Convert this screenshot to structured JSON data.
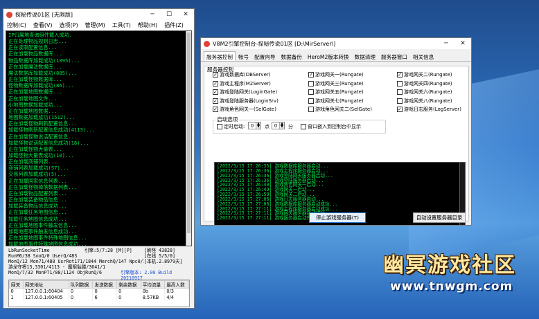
{
  "left_window": {
    "title": "探秘传说01区 [无限版]",
    "menu": [
      "控制(C)",
      "查看(V)",
      "选项(P)",
      "管理(M)",
      "工具(T)",
      "帮助(H)",
      "插件(Z)"
    ],
    "log_lines": [
      "IP归属地查询组件载入成功.",
      "正在处理物品规则日志...",
      "正在读取配置信息...",
      "正在加载物品数据库...",
      "物品数据库加载成功(1095)...",
      "正在加载魔法数据库...",
      "魔法数据库加载成功(885)...",
      "正在加载怪物数据库...",
      "怪物数据库加载成功(86)...",
      "正在加载地图数据库...",
      "正在加载地图文件...",
      "小地图数据加载成功...",
      "正在加载地图数据...",
      "地图数据加载成功(1512)...",
      "正在加载怪物刷新配置信息...",
      "加载怪物刷新配置信息成功(4113)...",
      "正在加载怪物说话配置信息...",
      "加载怪物说话配置信息成功(18)...",
      "正在加载怪物大量表...",
      "加载怪物大量表成功(10)...",
      "正在加载商铺列表...",
      "商铺列表加载成功(57)...",
      "交易列表加载成功(5)...",
      "正在加载国家信息列表...",
      "正在加载怪物掉落数据列表...",
      "正在加载物品配置列表...",
      "正在加载装备物品信息...",
      "加载装备物品信息成功...",
      "正在加载任务地图信息...",
      "加载任务地图信息成功...",
      "正在加载地图事件触发信息...",
      "加载地图事件触发信息成功...",
      "正在加载地图事件特殊地图信息...",
      "加载地图事件特殊地图信息成功...",
      "正在加载任务说明信息..."
    ],
    "stats": {
      "line1_left": "LbRunSocketTime",
      "line1_mid": "引擎:5/7:28 [M][P]",
      "line1_right": "[刷怪 43828]",
      "line2_left": "RunM6/38 SooQ/0 UserQ/483",
      "line2_right": "[在线 5/5/0]",
      "line3_left": "MonQ/12 Mon71/480 UsrRot171/1844 MerchQ/147 Npc0/135 (0)",
      "line3_right": "[本机.2.8979天]",
      "line4_left": "游龙守将13,3301/4113 - 魔眼骷髅/3641/1",
      "line5_left": "MonQ/7/32 MonP71/88/1124 ObjRunQ/6",
      "line5_right": "引擎版本: 2.00 Build 20210917"
    },
    "grid": {
      "headers": [
        "网关",
        "网关地址",
        "队列数据",
        "发送数据",
        "剩余数据",
        "平均流量",
        "最高人数"
      ],
      "rows": [
        [
          "0",
          "127.0.0.1:60404",
          "0",
          "0",
          "0",
          "0b",
          "0/3"
        ],
        [
          "1",
          "127.0.0.1:60405",
          "0",
          "6",
          "0",
          "8.57KB",
          "4/4"
        ]
      ]
    }
  },
  "right_window": {
    "title": "V8M2引擎控制台-探秘传说01区 [D:\\MirServer\\]",
    "tabs": [
      "服务器控制",
      "帐号",
      "配置向导",
      "数据备份",
      "HeroM2版本转换",
      "数据清理",
      "服务器窗口",
      "相关信息"
    ],
    "active_tab": 0,
    "section_server": "服务器控制",
    "checkboxes": [
      {
        "label": "游戏数据库(DBServer)",
        "checked": true
      },
      {
        "label": "游戏网关一(Rungate)",
        "checked": true
      },
      {
        "label": "游戏网关二(Rungate)",
        "checked": true
      },
      {
        "label": "游戏主程序(M2Server)",
        "checked": true
      },
      {
        "label": "游戏网关三(Rungate)",
        "checked": false
      },
      {
        "label": "游戏网关四(Rungate)",
        "checked": false
      },
      {
        "label": "游戏登陆网关(LoginGate)",
        "checked": true
      },
      {
        "label": "游戏网关五(Rungate)",
        "checked": false
      },
      {
        "label": "游戏网关六(Rungate)",
        "checked": false
      },
      {
        "label": "游戏登陆服务器(LoginSrv)",
        "checked": true
      },
      {
        "label": "游戏网关七(Rungate)",
        "checked": false
      },
      {
        "label": "游戏网关八(Rungate)",
        "checked": false
      },
      {
        "label": "游戏角色网关一(SelGate)",
        "checked": true
      },
      {
        "label": "游戏角色网关二(SelGate)",
        "checked": false
      },
      {
        "label": "游戏日志服务(LogServer)",
        "checked": true
      }
    ],
    "section_start": "启动选项",
    "timer_label": "定时启动:",
    "hour_value": "0",
    "hour_unit": "点",
    "minute_value": "0",
    "minute_unit": "分",
    "embed_label": "窗口嵌入到控制台中显示",
    "console_lines": [
      "[2022/3/15 17:26:35] 游戏数据库服务器启动...",
      "[2022/3/15 17:26:36] 游戏主程序服务器启动...",
      "[2022/3/15 17:26:36] 游戏登陆网关服务器启动...",
      "[2022/3/15 17:26:36] 游戏登陆服务器启动...",
      "[2022/3/15 17:26:40] 游戏角色网关一启动...",
      "[2022/3/15 17:26:49] 游戏网关一启动...",
      "[2022/3/15 17:26:59] 游戏网关二启动...",
      "[2022/3/15 17:27:06] 游戏日志服务器启动...",
      "[2022/3/15 17:27:06] 游戏数据库服务器启动成功...",
      "[2022/3/15 17:27:11] 游戏主程序服务器启动成功...",
      "[2022/3/15 17:27:11] 游戏网关服务器启动成功...",
      "[2022/3/15 17:27:11] 游戏服务器启动完成..."
    ],
    "stop_button": "停止游戏服务器(T)",
    "auto_button": "自动设置服务器目录"
  },
  "watermark": {
    "title": "幽冥游戏社区",
    "url": "www.tnwgm.com"
  }
}
